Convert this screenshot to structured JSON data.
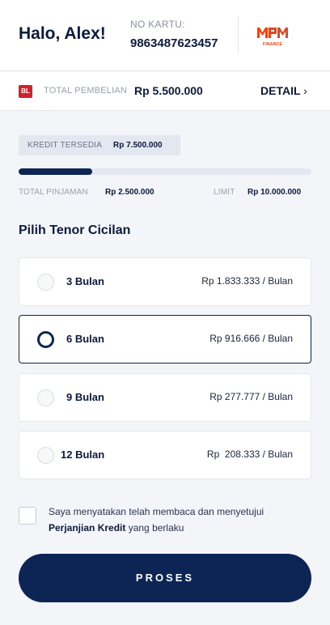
{
  "header": {
    "greeting": "Halo, Alex!",
    "card_label": "NO KARTU:",
    "card_number": "9863487623457",
    "logo_text": "FINANCE",
    "logo_color": "#e8471e"
  },
  "purchase": {
    "badge": "BL",
    "label": "TOTAL PEMBELIAN",
    "value": "Rp 5.500.000",
    "detail_label": "DETAIL",
    "detail_icon": "chevron-right-icon"
  },
  "credit": {
    "available_label": "KREDIT TERSEDIA",
    "available_value": "Rp 7.500.000",
    "usage_fraction": 0.25,
    "loan_label": "TOTAL PINJAMAN",
    "loan_value": "Rp 2.500.000",
    "limit_label": "LIMIT",
    "limit_value": "Rp 10.000.000"
  },
  "tenor": {
    "title": "Pilih Tenor Cicilan",
    "options": [
      {
        "label": "3 Bulan",
        "price": "Rp 1.833.333 / Bulan",
        "selected": false
      },
      {
        "label": "6 Bulan",
        "price": "Rp 916.666 / Bulan",
        "selected": true
      },
      {
        "label": "9 Bulan",
        "price": "Rp 277.777 / Bulan",
        "selected": false
      },
      {
        "label": "12 Bulan",
        "price": "Rp  208.333 / Bulan",
        "selected": false
      }
    ]
  },
  "agreement": {
    "text_before": "Saya menyatakan telah membaca dan menyetujui",
    "link": "Perjanjian Kredit",
    "text_after": " yang berlaku",
    "checked": false
  },
  "actions": {
    "process_label": "PROSES"
  },
  "colors": {
    "primary": "#0c2555",
    "badge_red": "#d3222c",
    "background": "#f4f5f8"
  }
}
